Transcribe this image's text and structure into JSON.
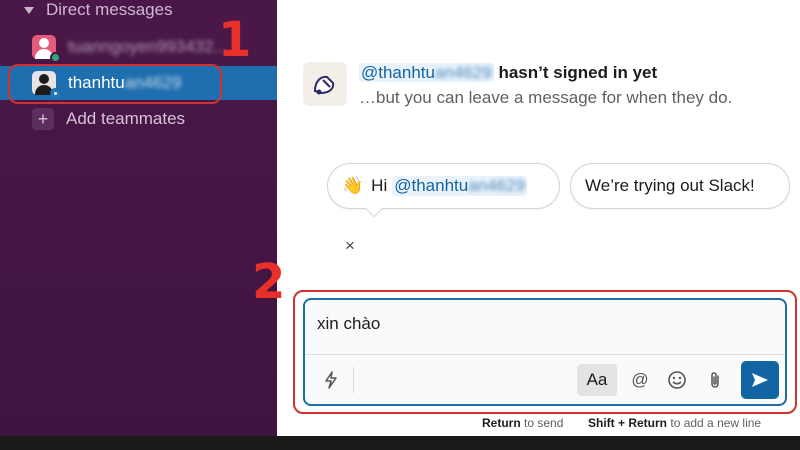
{
  "sidebar": {
    "section_label": "Direct messages",
    "items": [
      {
        "label": "tuanngoyen993432...",
        "state": "online"
      },
      {
        "label": "thanhtuan4629",
        "state": "away",
        "active": true
      }
    ],
    "add_label": "Add teammates"
  },
  "annotations": {
    "first": "1",
    "second": "2"
  },
  "notice": {
    "mention": "@thanhtuan4629",
    "headline_suffix": "hasn’t signed in yet",
    "subline": "…but you can leave a message for when they do."
  },
  "suggestions": {
    "greeting_emoji": "👋",
    "greeting_text": "Hi",
    "greeting_mention": "@thanhtuan4629",
    "second": "We’re trying out Slack!"
  },
  "close_glyph": "×",
  "composer": {
    "value": "xin chào",
    "toolbar": {
      "shortcuts_icon": "lightning-icon",
      "format_label": "Aa",
      "mention_glyph": "@",
      "emoji_icon": "smiley-icon",
      "attach_icon": "paperclip-icon",
      "send_icon": "send-arrow-icon"
    }
  },
  "hints": {
    "send_key": "Return",
    "send_text": "to send",
    "newline_key": "Shift + Return",
    "newline_text": "to add a new line"
  },
  "colors": {
    "sidebar_bg": "#4a154b",
    "active_item": "#1f6fb0",
    "annotation_red": "#d0322f",
    "send_button": "#1264a3",
    "mention_blue": "#1264a3"
  }
}
